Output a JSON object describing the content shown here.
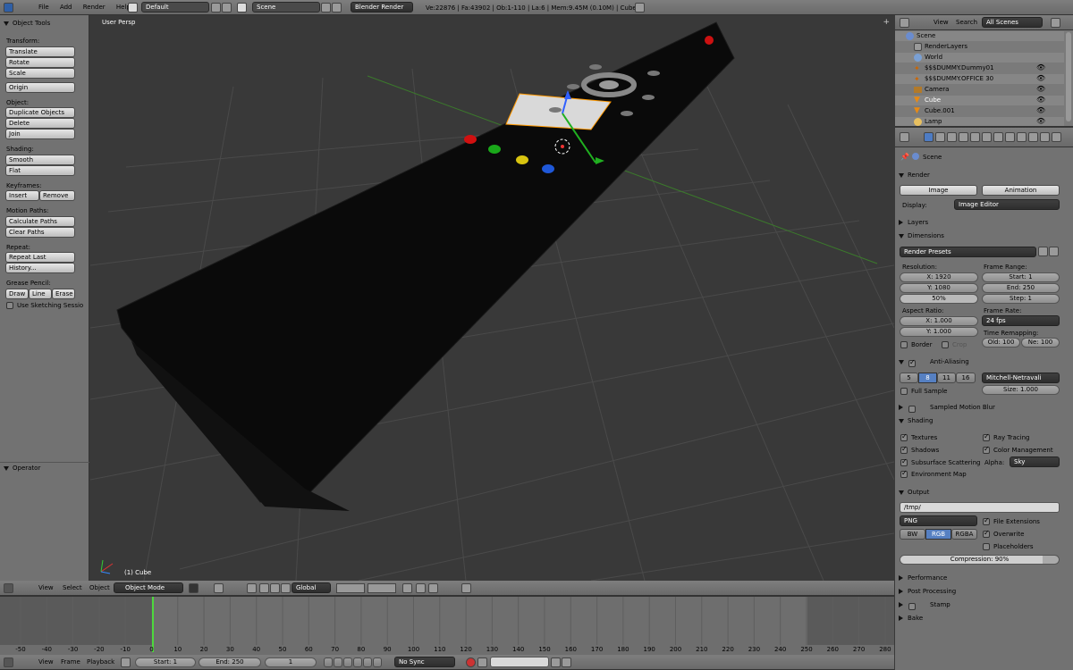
{
  "info_bar": {
    "menus": [
      "File",
      "Add",
      "Render",
      "Help"
    ],
    "layout": "Default",
    "scene": "Scene",
    "engine": "Blender Render",
    "stats": "Ve:22876 | Fa:43902 | Ob:1-110 | La:6 | Mem:9.45M (0.10M) | Cube"
  },
  "tool_shelf": {
    "title": "Object Tools",
    "transform_label": "Transform:",
    "translate": "Translate",
    "rotate": "Rotate",
    "scale": "Scale",
    "origin": "Origin",
    "object_label": "Object:",
    "duplicate": "Duplicate Objects",
    "delete": "Delete",
    "join": "Join",
    "shading_label": "Shading:",
    "smooth": "Smooth",
    "flat": "Flat",
    "keyframes_label": "Keyframes:",
    "insert": "Insert",
    "remove": "Remove",
    "motion_paths_label": "Motion Paths:",
    "calc_paths": "Calculate Paths",
    "clear_paths": "Clear Paths",
    "repeat_label": "Repeat:",
    "repeat_last": "Repeat Last",
    "history": "History...",
    "grease_label": "Grease Pencil:",
    "draw": "Draw",
    "line": "Line",
    "erase": "Erase",
    "sketching": "Use Sketching Sessio",
    "operator": "Operator"
  },
  "viewport": {
    "view_name": "User Persp",
    "object_label": "(1) Cube"
  },
  "viewport_header": {
    "view": "View",
    "select": "Select",
    "object": "Object",
    "mode": "Object Mode",
    "orientation": "Global"
  },
  "outliner": {
    "view": "View",
    "search": "Search",
    "filter": "All Scenes",
    "items": [
      "Scene",
      "RenderLayers",
      "World",
      "$$$DUMMY.Dummy01",
      "$$$DUMMY.OFFICE 30",
      "Camera",
      "Cube",
      "Cube.001",
      "Lamp"
    ]
  },
  "properties": {
    "breadcrumb": "Scene",
    "render": {
      "header": "Render",
      "image": "Image",
      "animation": "Animation",
      "display_label": "Display:",
      "display_value": "Image Editor"
    },
    "layers": "Layers",
    "dimensions": {
      "header": "Dimensions",
      "presets": "Render Presets",
      "resolution_label": "Resolution:",
      "res_x": "X: 1920",
      "res_y": "Y: 1080",
      "res_pct": "50%",
      "frame_range_label": "Frame Range:",
      "start": "Start: 1",
      "end": "End: 250",
      "step": "Step: 1",
      "aspect_label": "Aspect Ratio:",
      "aspect_x": "X: 1.000",
      "aspect_y": "Y: 1.000",
      "frame_rate_label": "Frame Rate:",
      "fps": "24 fps",
      "time_remap_label": "Time Remapping:",
      "old": "Old: 100",
      "new": "Ne: 100",
      "border": "Border",
      "crop": "Crop"
    },
    "anti_aliasing": {
      "header": "Anti-Aliasing",
      "samples": [
        "5",
        "8",
        "11",
        "16"
      ],
      "filter": "Mitchell-Netravali",
      "full_sample": "Full Sample",
      "size": "Size: 1.000"
    },
    "sampled_motion_blur": "Sampled Motion Blur",
    "shading": {
      "header": "Shading",
      "textures": "Textures",
      "ray_tracing": "Ray Tracing",
      "shadows": "Shadows",
      "color_management": "Color Management",
      "sss": "Subsurface Scattering",
      "alpha_label": "Alpha:",
      "alpha_value": "Sky",
      "env_map": "Environment Map"
    },
    "output": {
      "header": "Output",
      "path": "/tmp/",
      "format": "PNG",
      "file_ext": "File Extensions",
      "overwrite": "Overwrite",
      "placeholders": "Placeholders",
      "bw": "BW",
      "rgb": "RGB",
      "rgba": "RGBA",
      "compression": "Compression: 90%",
      "compression_value": 0.9
    },
    "performance": "Performance",
    "post_processing": "Post Processing",
    "stamp": "Stamp",
    "bake": "Bake"
  },
  "timeline": {
    "ticks": [
      "-50",
      "-40",
      "-30",
      "-20",
      "-10",
      "0",
      "10",
      "20",
      "30",
      "40",
      "50",
      "60",
      "70",
      "80",
      "90",
      "100",
      "110",
      "120",
      "130",
      "140",
      "150",
      "160",
      "170",
      "180",
      "190",
      "200",
      "210",
      "220",
      "230",
      "240",
      "250",
      "260",
      "270",
      "280"
    ],
    "view": "View",
    "frame": "Frame",
    "playback": "Playback",
    "start": "Start: 1",
    "end": "End: 250",
    "current": "1",
    "sync": "No Sync"
  }
}
